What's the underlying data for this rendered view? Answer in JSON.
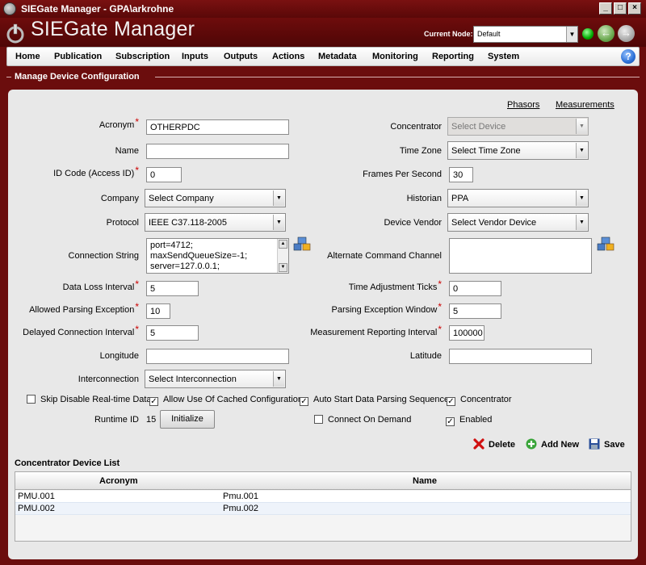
{
  "window": {
    "title": "SIEGate Manager - GPA\\arkrohne"
  },
  "header": {
    "brand": "SIEGate Manager",
    "current_node_label": "Current Node:",
    "current_node_value": "Default",
    "status_color": "#00aa00"
  },
  "menu": {
    "items": [
      "Home",
      "Publication",
      "Subscription",
      "Inputs",
      "Outputs",
      "Actions",
      "Metadata",
      "Monitoring",
      "Reporting",
      "System"
    ]
  },
  "page": {
    "title": "Manage Device Configuration",
    "links": {
      "phasors": "Phasors",
      "measurements": "Measurements"
    }
  },
  "form": {
    "acronym": {
      "label": "Acronym",
      "value": "OTHERPDC"
    },
    "name": {
      "label": "Name",
      "value": ""
    },
    "id_code": {
      "label": "ID Code (Access ID)",
      "value": "0"
    },
    "company": {
      "label": "Company",
      "value": "Select Company"
    },
    "protocol": {
      "label": "Protocol",
      "value": "IEEE C37.118-2005"
    },
    "connection_string": {
      "label": "Connection String",
      "lines": [
        "port=4712;",
        "maxSendQueueSize=-1;",
        "server=127.0.0.1;"
      ]
    },
    "data_loss_interval": {
      "label": "Data Loss Interval",
      "value": "5"
    },
    "allowed_parsing_exception": {
      "label": "Allowed Parsing Exception",
      "value": "10"
    },
    "delayed_connection_interval": {
      "label": "Delayed Connection Interval",
      "value": "5"
    },
    "longitude": {
      "label": "Longitude",
      "value": ""
    },
    "interconnection": {
      "label": "Interconnection",
      "value": "Select Interconnection"
    },
    "concentrator": {
      "label": "Concentrator",
      "value": "Select Device"
    },
    "time_zone": {
      "label": "Time Zone",
      "value": "Select Time Zone"
    },
    "frames_per_second": {
      "label": "Frames Per Second",
      "value": "30"
    },
    "historian": {
      "label": "Historian",
      "value": "PPA"
    },
    "device_vendor": {
      "label": "Device Vendor",
      "value": "Select Vendor Device"
    },
    "alternate_command_channel": {
      "label": "Alternate Command Channel",
      "value": ""
    },
    "time_adjustment_ticks": {
      "label": "Time Adjustment Ticks",
      "value": "0"
    },
    "parsing_exception_window": {
      "label": "Parsing Exception Window",
      "value": "5"
    },
    "measurement_reporting_interval": {
      "label": "Measurement Reporting Interval",
      "value": "100000"
    },
    "latitude": {
      "label": "Latitude",
      "value": ""
    },
    "checkboxes": {
      "skip_disable": {
        "label": "Skip Disable Real-time Data",
        "checked": false
      },
      "allow_cached": {
        "label": "Allow Use Of Cached Configuration",
        "checked": true
      },
      "auto_start": {
        "label": "Auto Start Data Parsing Sequence",
        "checked": true
      },
      "concentrator": {
        "label": "Concentrator",
        "checked": true
      },
      "connect_on_demand": {
        "label": "Connect On Demand",
        "checked": false
      },
      "enabled": {
        "label": "Enabled",
        "checked": true
      }
    },
    "runtime": {
      "label": "Runtime ID",
      "value": "15",
      "button": "Initialize"
    }
  },
  "actions": {
    "delete": "Delete",
    "add_new": "Add New",
    "save": "Save"
  },
  "device_list": {
    "title": "Concentrator Device List",
    "columns": [
      "Acronym",
      "Name"
    ],
    "rows": [
      {
        "acronym": "PMU.001",
        "name": "Pmu.001"
      },
      {
        "acronym": "PMU.002",
        "name": "Pmu.002"
      }
    ]
  }
}
